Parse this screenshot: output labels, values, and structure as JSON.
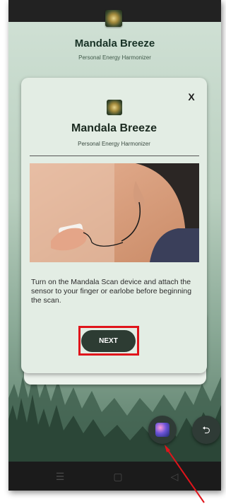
{
  "app": {
    "title": "Mandala Breeze",
    "subtitle": "Personal Energy Harmonizer"
  },
  "modal": {
    "title": "Mandala Breeze",
    "subtitle": "Personal Energy Harmonizer",
    "close_label": "X",
    "instructions": "Turn on the Mandala Scan device and attach the sensor to your finger or earlobe before beginning the scan.",
    "next_label": "NEXT"
  },
  "fab": {
    "back_glyph": "⮌"
  },
  "nav": {
    "menu_glyph": "☰",
    "home_glyph": "▢",
    "back_glyph": "◁"
  },
  "colors": {
    "highlight": "#e0141b",
    "button_dark": "#2d3c33"
  },
  "icons": [
    "app-logo-icon",
    "close-icon",
    "overlay-app-icon",
    "undo-icon",
    "menu-icon",
    "home-icon",
    "back-icon"
  ]
}
